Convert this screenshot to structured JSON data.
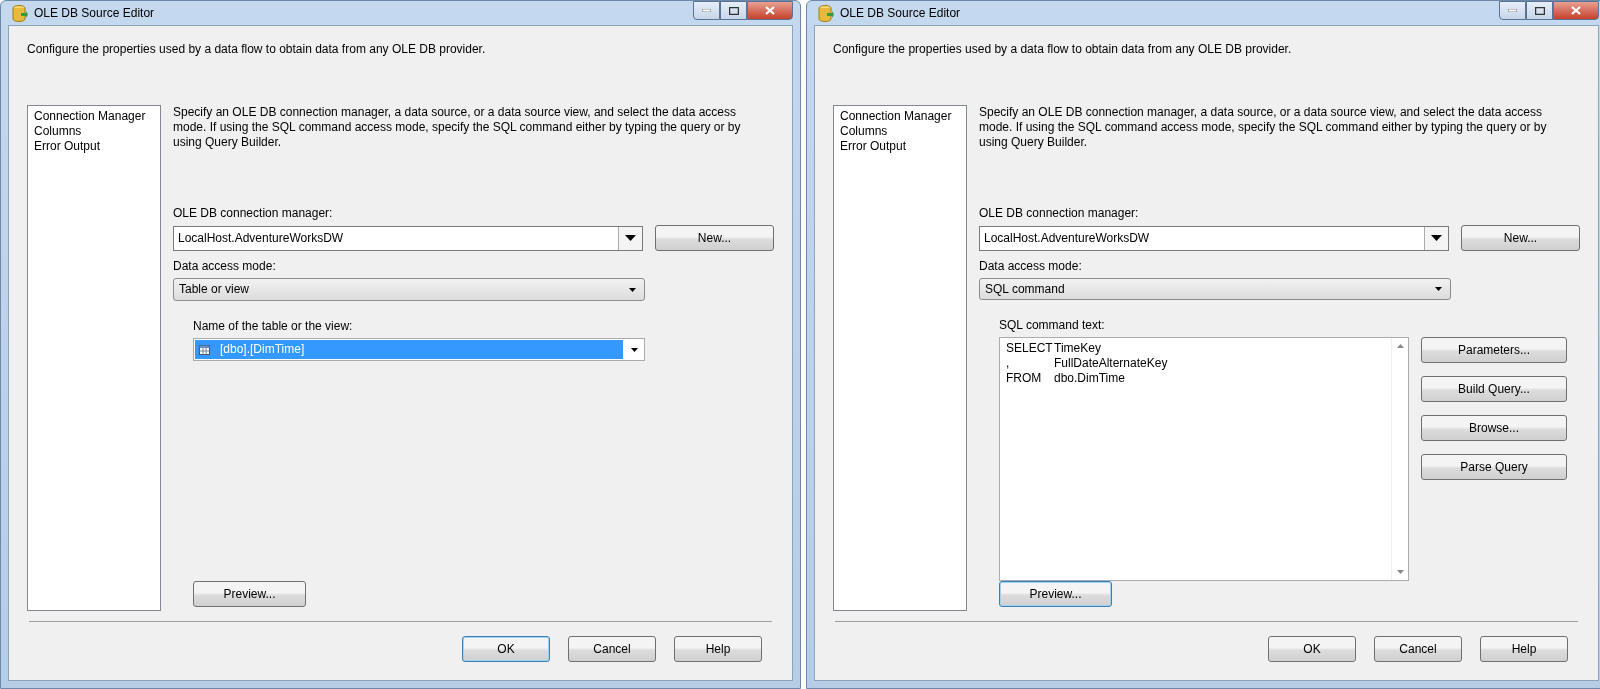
{
  "windows": [
    {
      "title": "OLE DB Source Editor",
      "description": "Configure the properties used by a data flow to obtain data from any OLE DB provider.",
      "pages": [
        {
          "label": "Connection Manager",
          "selected": false
        },
        {
          "label": "Columns",
          "selected": false
        },
        {
          "label": "Error Output",
          "selected": false
        }
      ],
      "instructions": "Specify an OLE DB connection manager, a data source, or a data source view, and select the data access mode. If using the SQL command access mode, specify the SQL command either by typing the query or by using Query Builder.",
      "connection_manager": {
        "label": "OLE DB connection manager:",
        "value": "LocalHost.AdventureWorksDW",
        "button": "New..."
      },
      "access_mode": {
        "label": "Data access mode:",
        "value": "Table or view"
      },
      "source": {
        "kind": "table",
        "label": "Name of the table or the view:",
        "value": "[dbo].[DimTime]",
        "selected": true
      },
      "preview_button": {
        "label": "Preview...",
        "focused": false
      },
      "footer_buttons": [
        {
          "label": "OK",
          "focused": true
        },
        {
          "label": "Cancel",
          "focused": false
        },
        {
          "label": "Help",
          "focused": false
        }
      ]
    },
    {
      "title": "OLE DB Source Editor",
      "description": "Configure the properties used by a data flow to obtain data from any OLE DB provider.",
      "pages": [
        {
          "label": "Connection Manager",
          "selected": false
        },
        {
          "label": "Columns",
          "selected": false
        },
        {
          "label": "Error Output",
          "selected": false
        }
      ],
      "instructions": "Specify an OLE DB connection manager, a data source, or a data source view, and select the data access mode. If using the SQL command access mode, specify the SQL command either by typing the query or by using Query Builder.",
      "connection_manager": {
        "label": "OLE DB connection manager:",
        "value": "LocalHost.AdventureWorksDW",
        "button": "New..."
      },
      "access_mode": {
        "label": "Data access mode:",
        "value": "SQL command"
      },
      "source": {
        "kind": "sql",
        "label": "SQL command text:",
        "lines": [
          {
            "keyword": "SELECT",
            "expression": "TimeKey"
          },
          {
            "keyword": ",",
            "expression": "FullDateAlternateKey"
          },
          {
            "keyword": "FROM",
            "expression": "dbo.DimTime"
          }
        ],
        "buttons": [
          "Parameters...",
          "Build Query...",
          "Browse...",
          "Parse Query"
        ]
      },
      "preview_button": {
        "label": "Preview...",
        "focused": true
      },
      "footer_buttons": [
        {
          "label": "OK",
          "focused": false
        },
        {
          "label": "Cancel",
          "focused": false
        },
        {
          "label": "Help",
          "focused": false
        }
      ]
    }
  ]
}
